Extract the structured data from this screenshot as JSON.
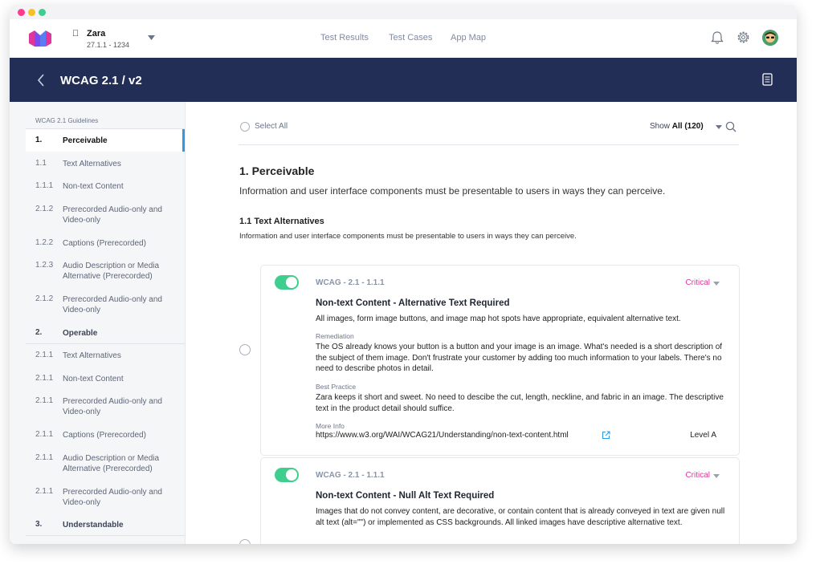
{
  "app": {
    "name": "Zara",
    "version": "27.1.1 - 1234",
    "platform_icon": "apple-icon"
  },
  "nav": [
    "Test Results",
    "Test Cases",
    "App Map"
  ],
  "header": {
    "title": "WCAG 2.1 / v2"
  },
  "sidebar": {
    "heading": "WCAG 2.1 Guidelines",
    "items": [
      {
        "num": "1.",
        "label": "Perceivable",
        "section": true,
        "active": true
      },
      {
        "num": "1.1",
        "label": "Text Alternatives"
      },
      {
        "num": "1.1.1",
        "label": "Non-text Content"
      },
      {
        "num": "2.1.2",
        "label": "Prerecorded Audio-only and Video-only"
      },
      {
        "num": "1.2.2",
        "label": "Captions (Prerecorded)"
      },
      {
        "num": "1.2.3",
        "label": "Audio Description or Media Alternative (Prerecorded)"
      },
      {
        "num": "2.1.2",
        "label": "Prerecorded Audio-only and Video-only"
      },
      {
        "num": "2.",
        "label": "Operable",
        "section": true
      },
      {
        "num": "2.1.1",
        "label": "Text Alternatives"
      },
      {
        "num": "2.1.1",
        "label": "Non-text Content"
      },
      {
        "num": "2.1.1",
        "label": "Prerecorded Audio-only and Video-only"
      },
      {
        "num": "2.1.1",
        "label": "Captions (Prerecorded)"
      },
      {
        "num": "2.1.1",
        "label": "Audio Description or Media Alternative (Prerecorded)"
      },
      {
        "num": "2.1.1",
        "label": "Prerecorded Audio-only and Video-only"
      },
      {
        "num": "3.",
        "label": "Understandable",
        "section": true
      }
    ]
  },
  "main": {
    "select_all": "Select All",
    "show_prefix": "Show",
    "show_value": "All (120)",
    "section_title": "1. Perceivable",
    "section_desc": "Information and user interface components must be presentable to users in ways they can perceive.",
    "sub_title": "1.1 Text Alternatives",
    "sub_desc": "Information and user interface components must be presentable to users in ways they can perceive.",
    "cards": [
      {
        "code": "WCAG - 2.1 - 1.1.1",
        "severity": "Critical",
        "title": "Non-text Content - Alternative Text Required",
        "desc": "All images, form image buttons, and image map hot spots have appropriate, equivalent alternative text.",
        "remediation_label": "Remediation",
        "remediation": "The OS already knows your button is a button and your image is an image. What's needed is a short description of the subject of them image.  Don't frustrate your customer by adding too much information to your labels. There's no need to describe photos in detail.",
        "best_label": "Best Practice",
        "best": "Zara keeps it short and sweet. No need to descibe the cut, length, neckline, and fabric in an image. The descriptive text in the product detail should suffice.",
        "more_label": "More Info",
        "link": "https://www.w3.org/WAI/WCAG21/Understanding/non-text-content.html",
        "level": "Level A"
      },
      {
        "code": "WCAG - 2.1 - 1.1.1",
        "severity": "Critical",
        "title": "Non-text Content - Null Alt Text Required",
        "desc": "Images that do not convey content, are decorative, or contain content that is already conveyed in text are given null alt text (alt=\"\") or implemented as CSS backgrounds. All linked images have descriptive alternative text."
      }
    ]
  },
  "colors": {
    "header_bg": "#222e55",
    "toggle_on": "#3ecf8e",
    "critical": "#e0369c",
    "active_accent": "#2e9be0"
  }
}
